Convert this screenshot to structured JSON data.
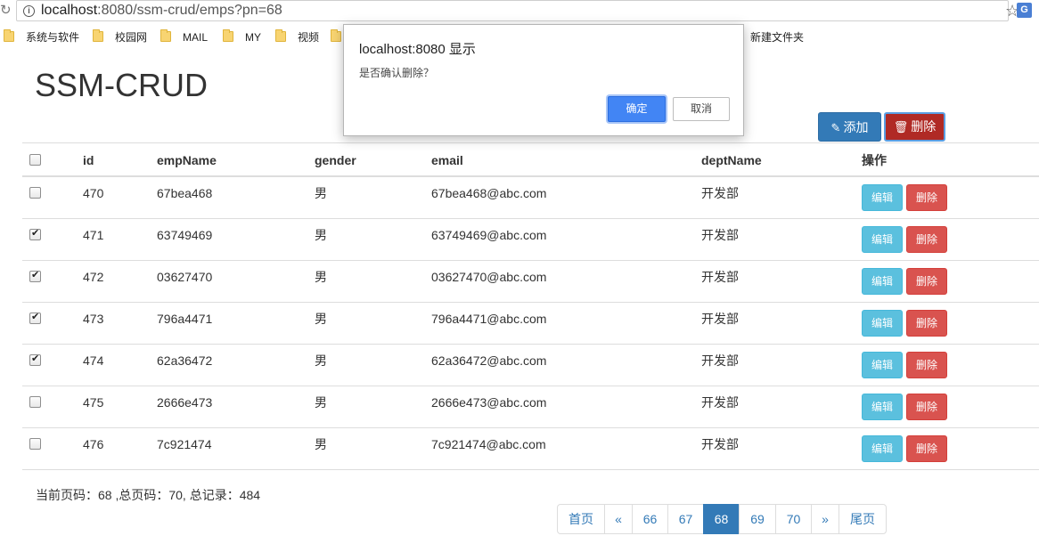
{
  "browser": {
    "url_host": "localhost",
    "url_rest": ":8080/ssm-crud/emps?pn=68",
    "bookmarks": [
      "系统与软件",
      "校园网",
      "MAIL",
      "MY",
      "视频",
      "新建文件夹"
    ]
  },
  "page": {
    "title": "SSM-CRUD",
    "add_label": "添加",
    "delete_all_label": "删除"
  },
  "table": {
    "headers": [
      "id",
      "empName",
      "gender",
      "email",
      "deptName",
      "操作"
    ],
    "edit_label": "编辑",
    "delete_label": "删除",
    "rows": [
      {
        "checked": false,
        "id": "470",
        "name": "67bea468",
        "gender": "男",
        "email": "67bea468@abc.com",
        "dept": "开发部"
      },
      {
        "checked": true,
        "id": "471",
        "name": "63749469",
        "gender": "男",
        "email": "63749469@abc.com",
        "dept": "开发部"
      },
      {
        "checked": true,
        "id": "472",
        "name": "03627470",
        "gender": "男",
        "email": "03627470@abc.com",
        "dept": "开发部"
      },
      {
        "checked": true,
        "id": "473",
        "name": "796a4471",
        "gender": "男",
        "email": "796a4471@abc.com",
        "dept": "开发部"
      },
      {
        "checked": true,
        "id": "474",
        "name": "62a36472",
        "gender": "男",
        "email": "62a36472@abc.com",
        "dept": "开发部"
      },
      {
        "checked": false,
        "id": "475",
        "name": "2666e473",
        "gender": "男",
        "email": "2666e473@abc.com",
        "dept": "开发部"
      },
      {
        "checked": false,
        "id": "476",
        "name": "7c921474",
        "gender": "男",
        "email": "7c921474@abc.com",
        "dept": "开发部"
      }
    ]
  },
  "pageinfo": "当前页码：68 ,总页码：70, 总记录：484",
  "pagination": {
    "first": "首页",
    "prev": "«",
    "pages": [
      "66",
      "67",
      "68",
      "69",
      "70"
    ],
    "current": "68",
    "next": "»",
    "last": "尾页"
  },
  "dialog": {
    "title": "localhost:8080 显示",
    "message": "是否确认删除？",
    "ok_label": "确定",
    "cancel_label": "取消"
  },
  "colors": {
    "primary": "#337ab7",
    "danger": "#d9534f",
    "info": "#5bc0de",
    "dialog_ok": "#4285f4"
  }
}
